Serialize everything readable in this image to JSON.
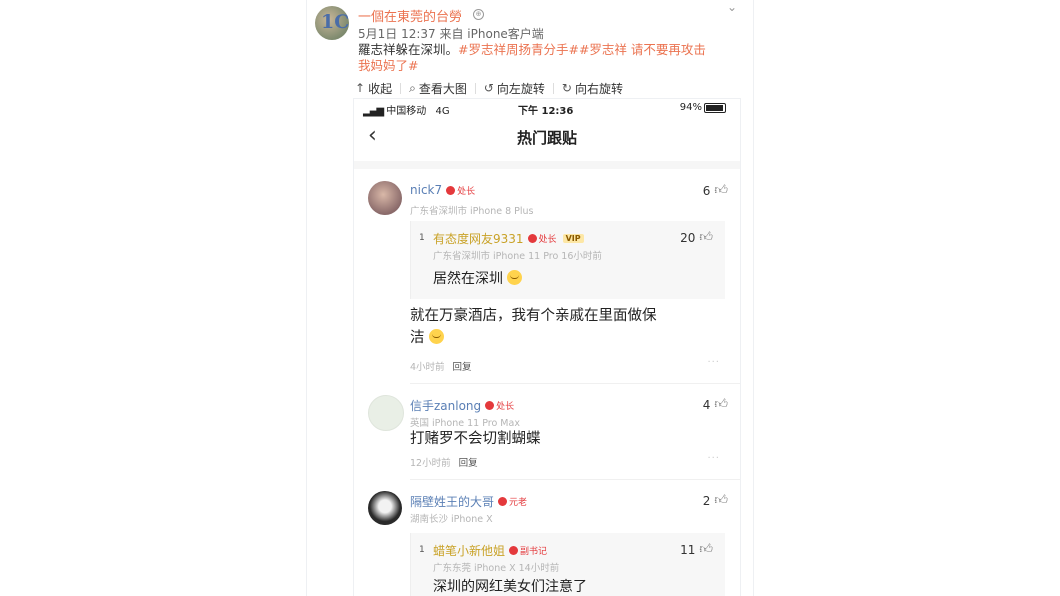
{
  "post": {
    "author_name": "一個在東莞的台勞",
    "author_badge": "⊕",
    "avatar_text": "1C",
    "meta": "5月1日 12:37 来自 iPhone客户端",
    "text_plain": "羅志祥躲在深圳。",
    "text_tags_line1": "#罗志祥周扬青分手##罗志祥 请不要再攻击",
    "text_tags_line2": "我妈妈了#",
    "collapse_icon": "chevron-down-icon"
  },
  "toolbar": {
    "items": [
      {
        "icon": "↑",
        "label": "收起"
      },
      {
        "icon": "⌕",
        "label": "查看大图"
      },
      {
        "icon": "↺",
        "label": "向左旋转"
      },
      {
        "icon": "↻",
        "label": "向右旋转"
      }
    ]
  },
  "phone": {
    "status": {
      "signal": "▂▄▆",
      "carrier": "中国移动",
      "network": "4G",
      "time": "下午 12:36",
      "battery_label": "94%",
      "battery_level": 0.94
    },
    "nav": {
      "back": "‹",
      "title": "热门跟贴"
    },
    "comments": [
      {
        "name": "nick7",
        "badge": "处长",
        "sub": "广东省深圳市  iPhone 8 Plus",
        "likes": "6",
        "quote": {
          "num": "1",
          "name": "有态度网友9331",
          "badge": "处长",
          "vip": "VIP",
          "likes": "20",
          "sub": "广东省深圳市  iPhone 11 Pro  16小时前",
          "text": "居然在深圳"
        },
        "text_line1": "就在万豪酒店，我有个亲戚在里面做保",
        "text_line2": "洁",
        "time": "4小时前",
        "reply": "回复",
        "more": "···"
      },
      {
        "name": "信手zanlong",
        "badge": "处长",
        "sub": "英国  iPhone 11 Pro Max",
        "likes": "4",
        "text_line1": "打赌罗不会切割蝴蝶",
        "time": "12小时前",
        "reply": "回复",
        "more": "···"
      },
      {
        "name": "隔壁姓王的大哥",
        "badge": "元老",
        "sub": "湖南长沙  iPhone X",
        "likes": "2",
        "quote": {
          "num": "1",
          "name": "蜡笔小新他姐",
          "badge": "副书记",
          "likes": "11",
          "sub": "广东东莞  iPhone X  14小时前",
          "text": "深圳的网红美女们注意了"
        }
      }
    ]
  },
  "colors": {
    "accent": "#eb7350",
    "link_blue": "#5a7fb5",
    "badge_red": "#e4393c",
    "gold": "#c9a227"
  }
}
